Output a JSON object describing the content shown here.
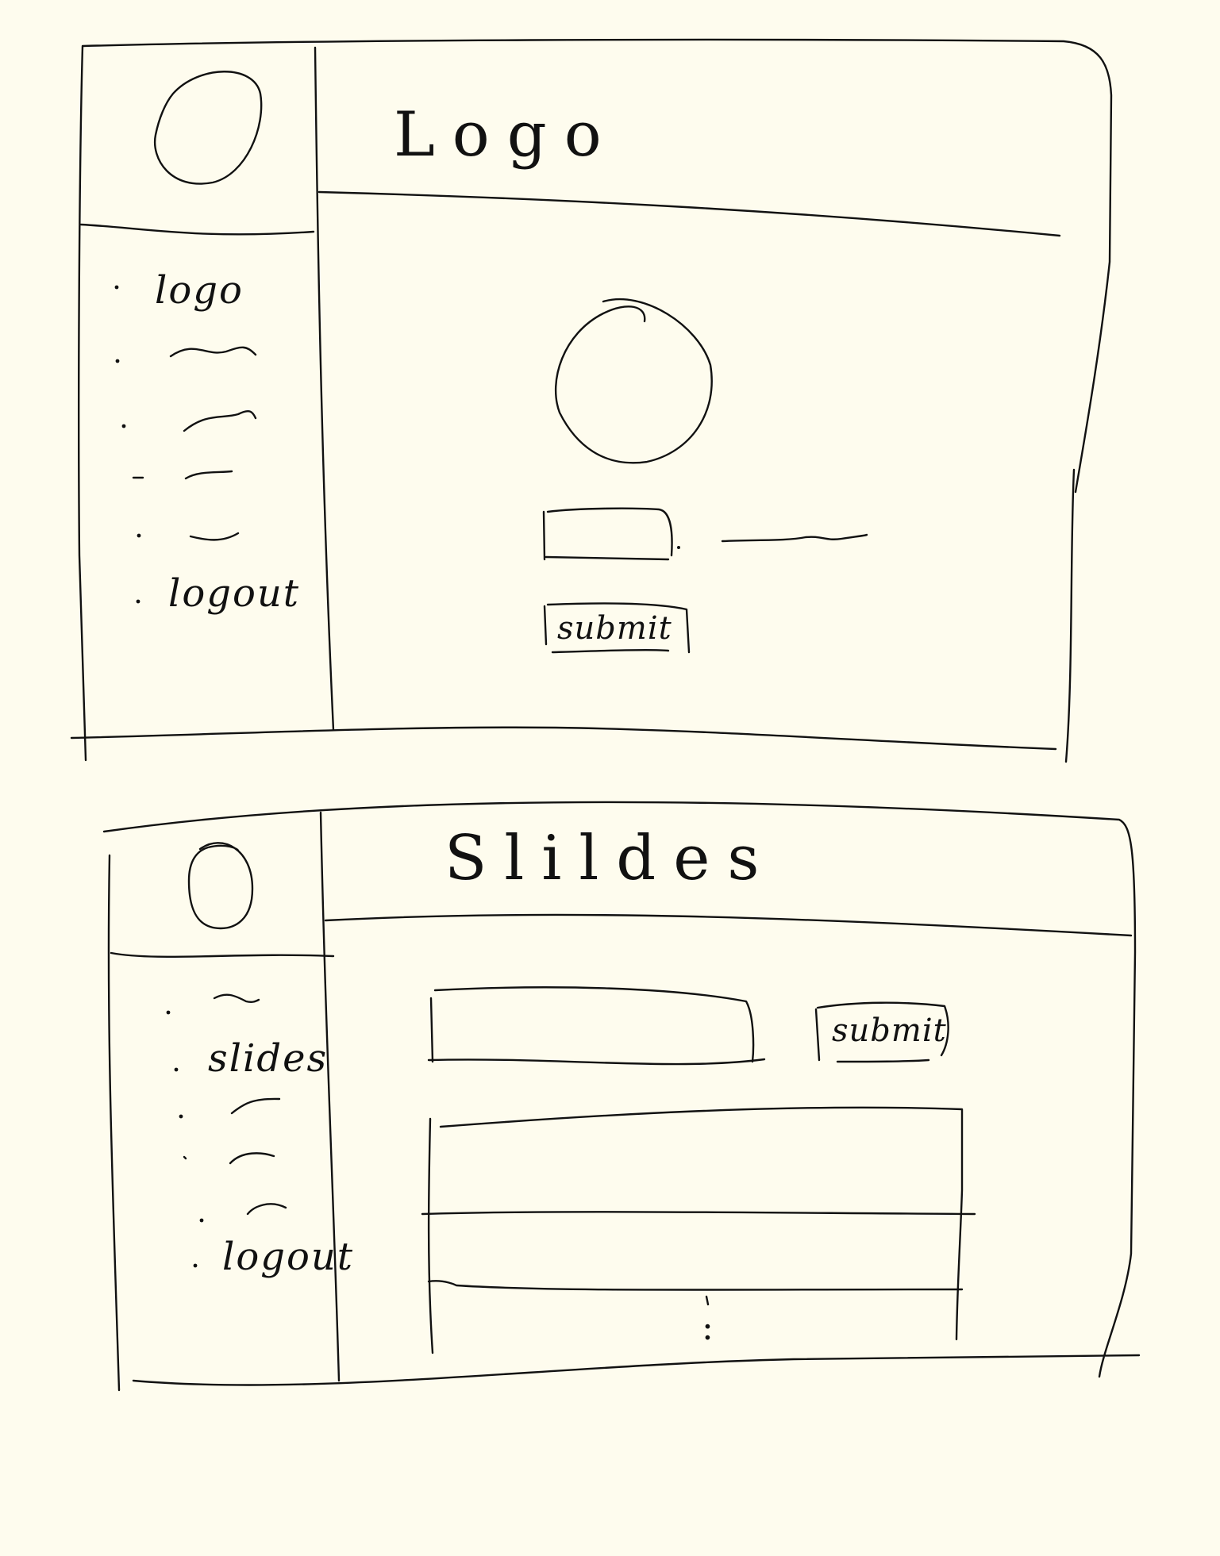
{
  "screen_1": {
    "header": {
      "title": "Logo"
    },
    "sidebar": {
      "items": [
        {
          "label": "logo"
        },
        {
          "label": ""
        },
        {
          "label": ""
        },
        {
          "label": ""
        },
        {
          "label": ""
        },
        {
          "label": "logout"
        }
      ]
    },
    "main": {
      "submit_label": "submit"
    }
  },
  "screen_2": {
    "header": {
      "title": "Slildes"
    },
    "sidebar": {
      "items": [
        {
          "label": ""
        },
        {
          "label": "slides"
        },
        {
          "label": ""
        },
        {
          "label": ""
        },
        {
          "label": ""
        },
        {
          "label": "logout"
        }
      ]
    },
    "main": {
      "submit_label": "submit",
      "table_more": ":"
    }
  }
}
